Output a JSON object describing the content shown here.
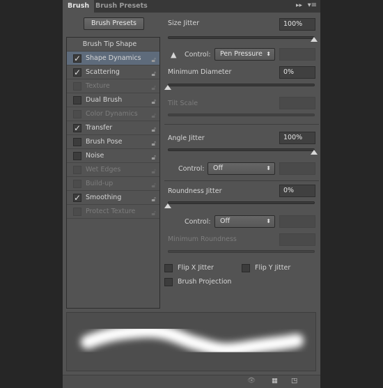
{
  "tabs": [
    {
      "label": "Brush",
      "active": true
    },
    {
      "label": "Brush Presets",
      "active": false
    }
  ],
  "presets_button": "Brush Presets",
  "list": {
    "header": "Brush Tip Shape",
    "items": [
      {
        "label": "Shape Dynamics",
        "checked": true,
        "enabled": true,
        "selected": true
      },
      {
        "label": "Scattering",
        "checked": true,
        "enabled": true
      },
      {
        "label": "Texture",
        "checked": false,
        "enabled": false
      },
      {
        "label": "Dual Brush",
        "checked": false,
        "enabled": true
      },
      {
        "label": "Color Dynamics",
        "checked": false,
        "enabled": false
      },
      {
        "label": "Transfer",
        "checked": true,
        "enabled": true
      },
      {
        "label": "Brush Pose",
        "checked": false,
        "enabled": true
      },
      {
        "label": "Noise",
        "checked": false,
        "enabled": true
      },
      {
        "label": "Wet Edges",
        "checked": false,
        "enabled": false
      },
      {
        "label": "Build-up",
        "checked": false,
        "enabled": false
      },
      {
        "label": "Smoothing",
        "checked": true,
        "enabled": true
      },
      {
        "label": "Protect Texture",
        "checked": false,
        "enabled": false
      }
    ]
  },
  "settings": {
    "size_jitter": {
      "label": "Size Jitter",
      "value": "100%",
      "level": 1.0
    },
    "control1": {
      "label": "Control:",
      "value": "Pen Pressure"
    },
    "min_diameter": {
      "label": "Minimum Diameter",
      "value": "0%",
      "level": 0
    },
    "tilt_scale": {
      "label": "Tilt Scale"
    },
    "angle_jitter": {
      "label": "Angle Jitter",
      "value": "100%",
      "level": 1.0
    },
    "control2": {
      "label": "Control:",
      "value": "Off"
    },
    "roundness_jitter": {
      "label": "Roundness Jitter",
      "value": "0%",
      "level": 0
    },
    "control3": {
      "label": "Control:",
      "value": "Off"
    },
    "min_roundness": {
      "label": "Minimum Roundness"
    },
    "flip_x": "Flip X Jitter",
    "flip_y": "Flip Y Jitter",
    "projection": "Brush Projection"
  }
}
